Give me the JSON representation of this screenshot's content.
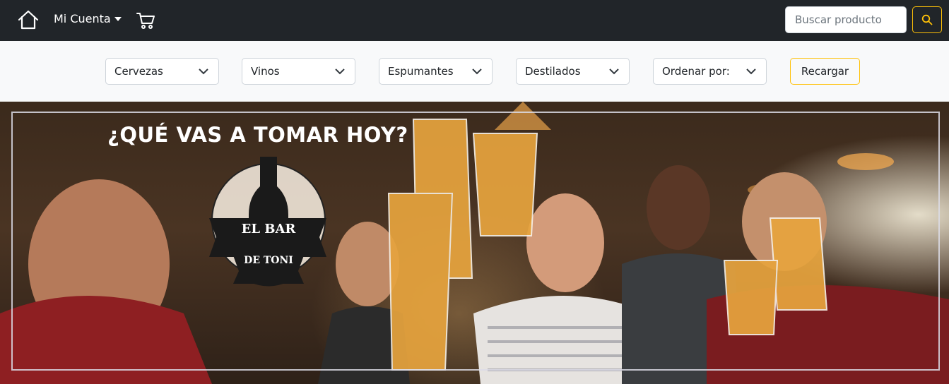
{
  "navbar": {
    "home_icon": "home-icon",
    "account_label": "Mi Cuenta",
    "cart_icon": "cart-icon",
    "search_placeholder": "Buscar producto",
    "search_icon": "search-icon"
  },
  "filters": {
    "selects": [
      {
        "label": "Cervezas"
      },
      {
        "label": "Vinos"
      },
      {
        "label": "Espumantes"
      },
      {
        "label": "Destilados"
      },
      {
        "label": "Ordenar por:"
      }
    ],
    "reload_label": "Recargar"
  },
  "hero": {
    "title": "¿QUÉ VAS A TOMAR HOY?",
    "logo_line1": "EL BAR",
    "logo_line2": "DE TONI"
  },
  "colors": {
    "navbar_bg": "#212529",
    "accent": "#ffc107",
    "filterbar_bg": "#f8f9fa"
  }
}
